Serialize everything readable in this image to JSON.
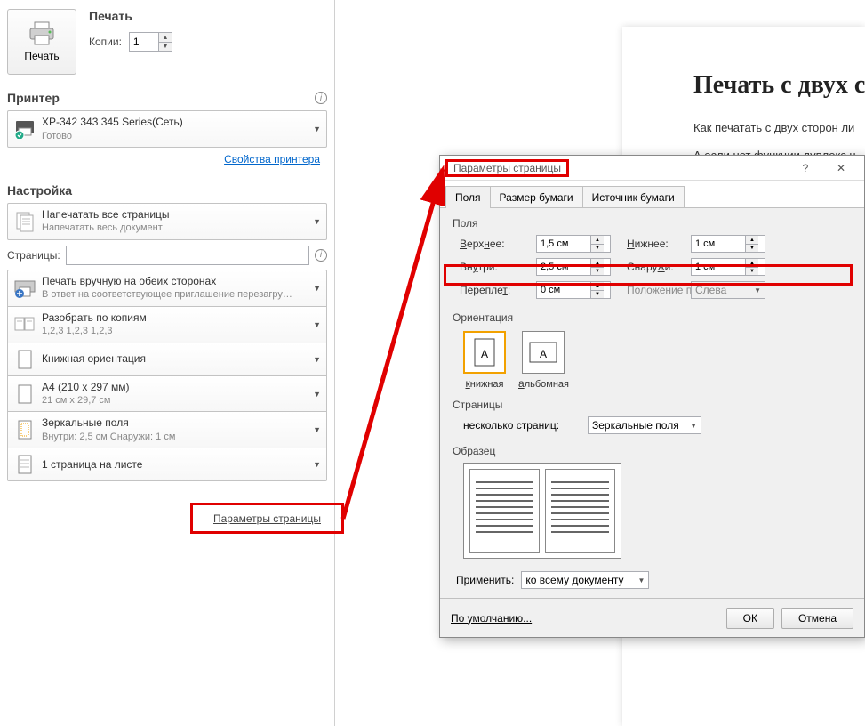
{
  "print": {
    "title": "Печать",
    "btn": "Печать",
    "copies_label": "Копии:",
    "copies_value": "1"
  },
  "printer": {
    "title": "Принтер",
    "name": "XP-342 343 345 Series(Сеть)",
    "status": "Готово",
    "props_link": "Свойства принтера"
  },
  "settings": {
    "title": "Настройка",
    "print_all": {
      "l1": "Напечатать все страницы",
      "l2": "Напечатать весь документ"
    },
    "pages_label": "Страницы:",
    "pages_value": "",
    "duplex": {
      "l1": "Печать вручную на обеих сторонах",
      "l2": "В ответ на соответствующее приглашение перезагру…"
    },
    "collate": {
      "l1": "Разобрать по копиям",
      "l2": "1,2,3    1,2,3    1,2,3"
    },
    "orient": {
      "l1": "Книжная ориентация"
    },
    "paper": {
      "l1": "A4 (210 x 297 мм)",
      "l2": "21 см x 29,7 см"
    },
    "margins": {
      "l1": "Зеркальные поля",
      "l2": "Внутри:  2,5 см   Снаружи:  1 см"
    },
    "ppp": {
      "l1": "1 страница на листе"
    },
    "page_setup_link": "Параметры страницы"
  },
  "doc": {
    "h1": "Печать с двух ст",
    "p1": "Как печатать с двух сторон ли",
    "p2": "А если нет функции дуплекс н"
  },
  "dialog": {
    "title": "Параметры страницы",
    "tabs": [
      "Поля",
      "Размер бумаги",
      "Источник бумаги"
    ],
    "fields_title": "Поля",
    "top_lbl": "Верхнее:",
    "top_val": "1,5 см",
    "bot_lbl": "Нижнее:",
    "bot_val": "1 см",
    "in_lbl": "Внутри:",
    "in_val": "2,5 см",
    "out_lbl": "Снаружи:",
    "out_val": "1 см",
    "bind_lbl": "Переплет:",
    "bind_val": "0 см",
    "bindpos_lbl": "Положение переплета:",
    "bindpos_val": "Слева",
    "orient_title": "Ориентация",
    "portrait": "книжная",
    "landscape": "альбомная",
    "pages_title": "Страницы",
    "multi_lbl": "несколько страниц:",
    "multi_val": "Зеркальные поля",
    "sample_title": "Образец",
    "apply_lbl": "Применить:",
    "apply_val": "ко всему документу",
    "default_btn": "По умолчанию...",
    "ok": "ОК",
    "cancel": "Отмена"
  }
}
